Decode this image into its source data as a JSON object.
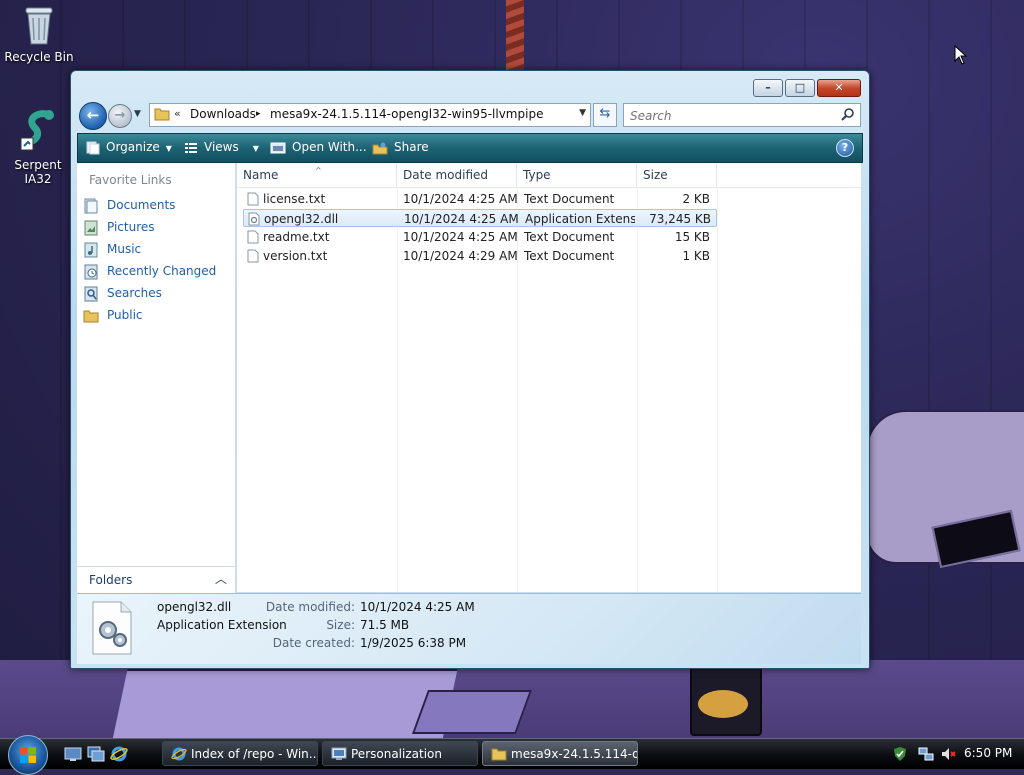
{
  "desktop": {
    "icons": [
      {
        "label": "Recycle Bin",
        "icon": "recycle-bin-icon"
      },
      {
        "label": "Serpent IA32",
        "icon": "serpent-icon"
      }
    ]
  },
  "window": {
    "title": "mesa9x-24.1.5.114-opengl32-win95-llvmpipe",
    "address": {
      "overflow_chevron": "«",
      "crumbs": [
        "Downloads",
        "mesa9x-24.1.5.114-opengl32-win95-llvmpipe"
      ],
      "separator": "▸"
    },
    "search": {
      "placeholder": "Search",
      "value": ""
    },
    "toolbar": {
      "organize": "Organize",
      "views": "Views",
      "open_with": "Open With...",
      "share": "Share",
      "help": "?"
    },
    "nav_pane": {
      "title": "Favorite Links",
      "links": [
        {
          "label": "Documents",
          "icon": "documents-icon"
        },
        {
          "label": "Pictures",
          "icon": "pictures-icon"
        },
        {
          "label": "Music",
          "icon": "music-icon"
        },
        {
          "label": "Recently Changed",
          "icon": "recently-changed-icon"
        },
        {
          "label": "Searches",
          "icon": "searches-icon"
        },
        {
          "label": "Public",
          "icon": "public-folder-icon"
        }
      ],
      "folders_label": "Folders"
    },
    "columns": [
      "Name",
      "Date modified",
      "Type",
      "Size"
    ],
    "files": [
      {
        "name": "license.txt",
        "date": "10/1/2024 4:25 AM",
        "type": "Text Document",
        "size": "2 KB",
        "selected": false,
        "icon": "text-file-icon"
      },
      {
        "name": "opengl32.dll",
        "date": "10/1/2024 4:25 AM",
        "type": "Application Extension",
        "type_display": "Application Extens...",
        "size": "73,245 KB",
        "selected": true,
        "icon": "dll-file-icon"
      },
      {
        "name": "readme.txt",
        "date": "10/1/2024 4:25 AM",
        "type": "Text Document",
        "size": "15 KB",
        "selected": false,
        "icon": "text-file-icon"
      },
      {
        "name": "version.txt",
        "date": "10/1/2024 4:29 AM",
        "type": "Text Document",
        "size": "1 KB",
        "selected": false,
        "icon": "text-file-icon"
      }
    ],
    "details": {
      "name": "opengl32.dll",
      "kind": "Application Extension",
      "date_modified_label": "Date modified:",
      "date_modified": "10/1/2024 4:25 AM",
      "size_label": "Size:",
      "size": "71.5 MB",
      "date_created_label": "Date created:",
      "date_created": "1/9/2025 6:38 PM"
    }
  },
  "taskbar": {
    "buttons": [
      {
        "label": "Index of /repo - Win...",
        "icon": "internet-explorer-icon",
        "active": false
      },
      {
        "label": "Personalization",
        "icon": "control-panel-icon",
        "active": false
      },
      {
        "label": "mesa9x-24.1.5.114-o...",
        "icon": "folder-icon",
        "active": true
      }
    ],
    "clock": "6:50 PM"
  }
}
